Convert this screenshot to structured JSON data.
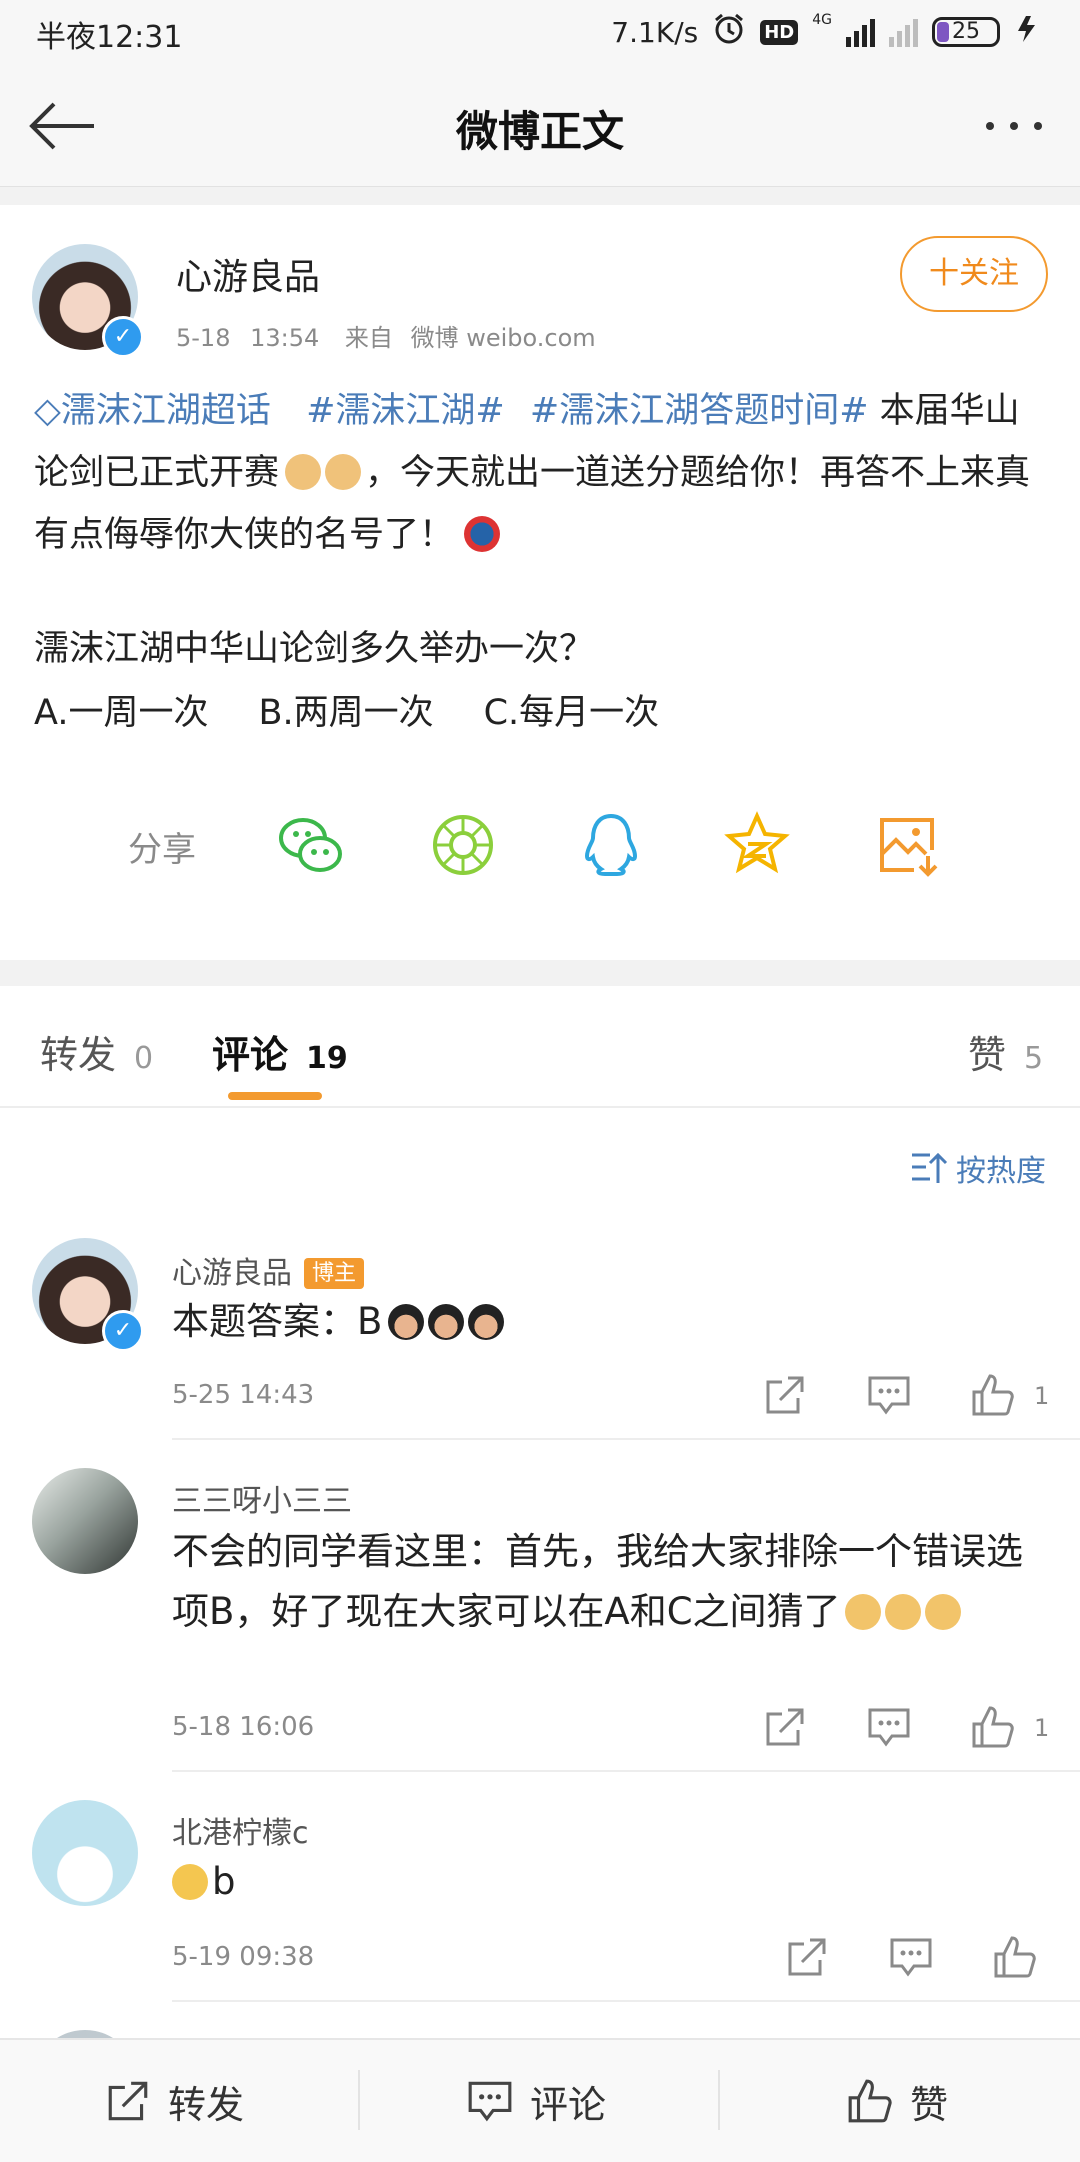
{
  "status_bar": {
    "time": "半夜12:31",
    "net_speed": "7.1K/s",
    "hd": "HD",
    "network_type": "4G",
    "battery": "25"
  },
  "nav": {
    "title": "微博正文"
  },
  "post": {
    "author": "心游良品",
    "date": "5-18",
    "time": "13:54",
    "source_prefix": "来自",
    "source": "微博 weibo.com",
    "follow_label": "十关注",
    "topic_super": "濡沫江湖超话",
    "topic_1": "#濡沫江湖#",
    "topic_2": "#濡沫江湖答题时间#",
    "text_1": "本届华山论剑已正式开赛",
    "text_2": "，今天就出一道送分题给你！再答不上来真有点侮辱你大侠的名号了！",
    "question": "濡沫江湖中华山论剑多久举办一次？",
    "option_a": "A.一周一次",
    "option_b": "B.两周一次",
    "option_c": "C.每月一次"
  },
  "share": {
    "label": "分享",
    "icons": [
      "wechat-icon",
      "moments-icon",
      "qq-icon",
      "qzone-icon",
      "save-image-icon"
    ]
  },
  "tabs": {
    "repost_label": "转发",
    "repost_count": "0",
    "comment_label": "评论",
    "comment_count": "19",
    "like_label": "赞",
    "like_count": "5"
  },
  "sort": {
    "label": "按热度"
  },
  "comments": [
    {
      "name": "心游良品",
      "badge": "博主",
      "text": "本题答案：B",
      "time": "5-25 14:43",
      "likes": "1"
    },
    {
      "name": "三三呀小三三",
      "text": "不会的同学看这里：首先，我给大家排除一个错误选项B，好了现在大家可以在A和C之间猜了",
      "time": "5-18 16:06",
      "likes": "1"
    },
    {
      "name": "北港柠檬c",
      "text": "b",
      "time": "5-19 09:38",
      "likes": ""
    }
  ],
  "bottom_bar": {
    "repost": "转发",
    "comment": "评论",
    "like": "赞"
  },
  "colors": {
    "accent": "#f39a2f",
    "link": "#4a7cb8",
    "verified": "#2f9bef"
  }
}
